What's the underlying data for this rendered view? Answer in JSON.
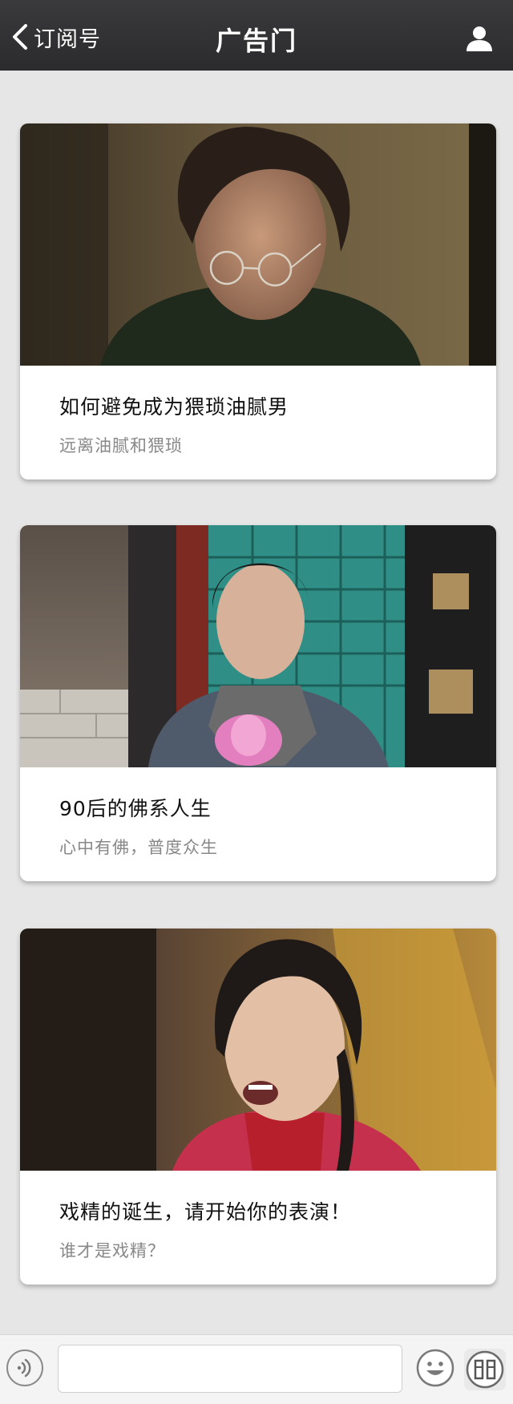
{
  "header": {
    "back_label": "订阅号",
    "title": "广告门"
  },
  "articles": [
    {
      "title": "如何避免成为猥琐油腻男",
      "subtitle": "远离油腻和猥琐"
    },
    {
      "title": "90后的佛系人生",
      "subtitle": "心中有佛，普度众生"
    },
    {
      "title": "戏精的诞生，请开始你的表演！",
      "subtitle": "谁才是戏精？"
    }
  ],
  "input": {
    "value": "",
    "placeholder": ""
  },
  "icons": {
    "back": "chevron-left-icon",
    "user": "user-icon",
    "voice": "voice-icon",
    "emoji": "emoji-icon",
    "menu": "menu-logo-icon"
  },
  "colors": {
    "header_bg": "#2b2b2d",
    "page_bg": "#e6e6e6",
    "card_bg": "#ffffff",
    "title_text": "#111111",
    "subtitle_text": "#888888"
  }
}
